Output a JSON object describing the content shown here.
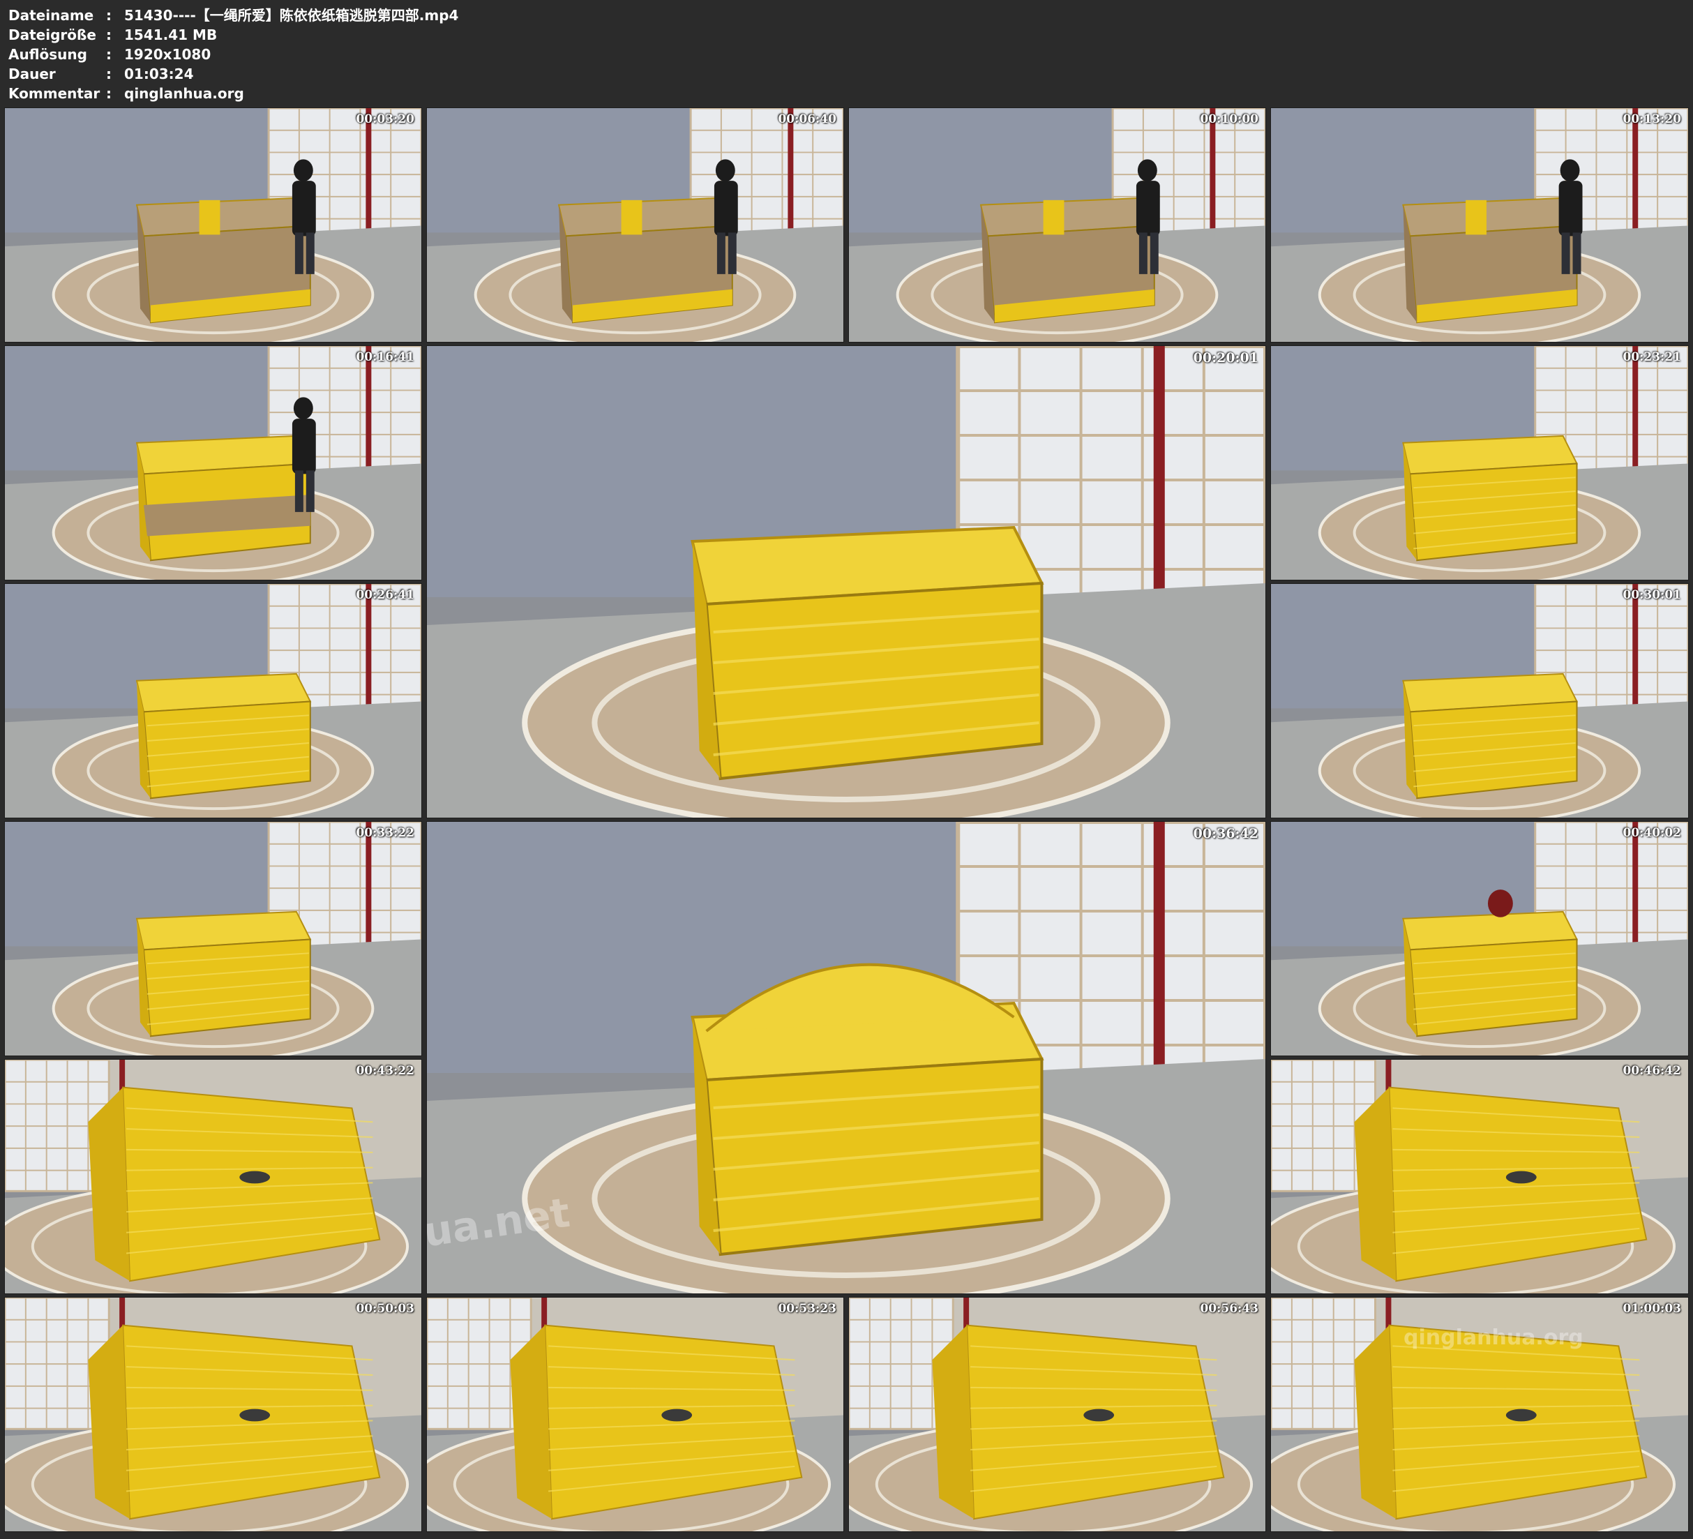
{
  "header": {
    "rows": [
      {
        "label": "Dateiname",
        "sep": ":",
        "value": "51430----【一绳所爱】陈依依纸箱逃脱第四部.mp4"
      },
      {
        "label": "Dateigröße",
        "sep": ":",
        "value": "1541.41 MB"
      },
      {
        "label": "Auflösung",
        "sep": ":",
        "value": "1920x1080"
      },
      {
        "label": "Dauer",
        "sep": ":",
        "value": "01:03:24"
      },
      {
        "label": "Kommentar",
        "sep": ":",
        "value": "qinglanhua.org"
      }
    ]
  },
  "thumbnails": [
    {
      "time": "00:03:20",
      "scene": "cardboard-box-with-person-kneeling"
    },
    {
      "time": "00:06:40",
      "scene": "cardboard-box-with-person-crouching"
    },
    {
      "time": "00:10:00",
      "scene": "cardboard-box-person-taping"
    },
    {
      "time": "00:13:20",
      "scene": "cardboard-box-person-holding-tape"
    },
    {
      "time": "00:16:41",
      "scene": "half-taped-box-person-working"
    },
    {
      "time": "00:20:01",
      "scene": "fully-taped-yellow-box-large"
    },
    {
      "time": "00:23:21",
      "scene": "taped-yellow-box"
    },
    {
      "time": "00:26:41",
      "scene": "taped-yellow-box"
    },
    {
      "time": "00:30:01",
      "scene": "taped-yellow-box"
    },
    {
      "time": "00:33:22",
      "scene": "taped-yellow-box"
    },
    {
      "time": "00:36:42",
      "scene": "taped-yellow-box-bulging-large"
    },
    {
      "time": "00:40:02",
      "scene": "taped-yellow-box-head-emerging"
    },
    {
      "time": "00:43:22",
      "scene": "taped-yellow-box-side-view"
    },
    {
      "time": "00:46:42",
      "scene": "taped-yellow-box-side-view"
    },
    {
      "time": "00:50:03",
      "scene": "taped-yellow-box-side-view"
    },
    {
      "time": "00:53:23",
      "scene": "taped-yellow-box-side-view"
    },
    {
      "time": "00:56:43",
      "scene": "taped-yellow-box-side-view"
    },
    {
      "time": "01:00:03",
      "scene": "taped-yellow-box-side-view"
    }
  ],
  "watermarks": {
    "center": "qinglanhua.net",
    "corner": "qinglanhua.org"
  },
  "colors": {
    "background": "#2b2b2b",
    "text": "#ffffff",
    "tape_yellow": "#e8c41a",
    "cardboard": "#a88d66"
  }
}
